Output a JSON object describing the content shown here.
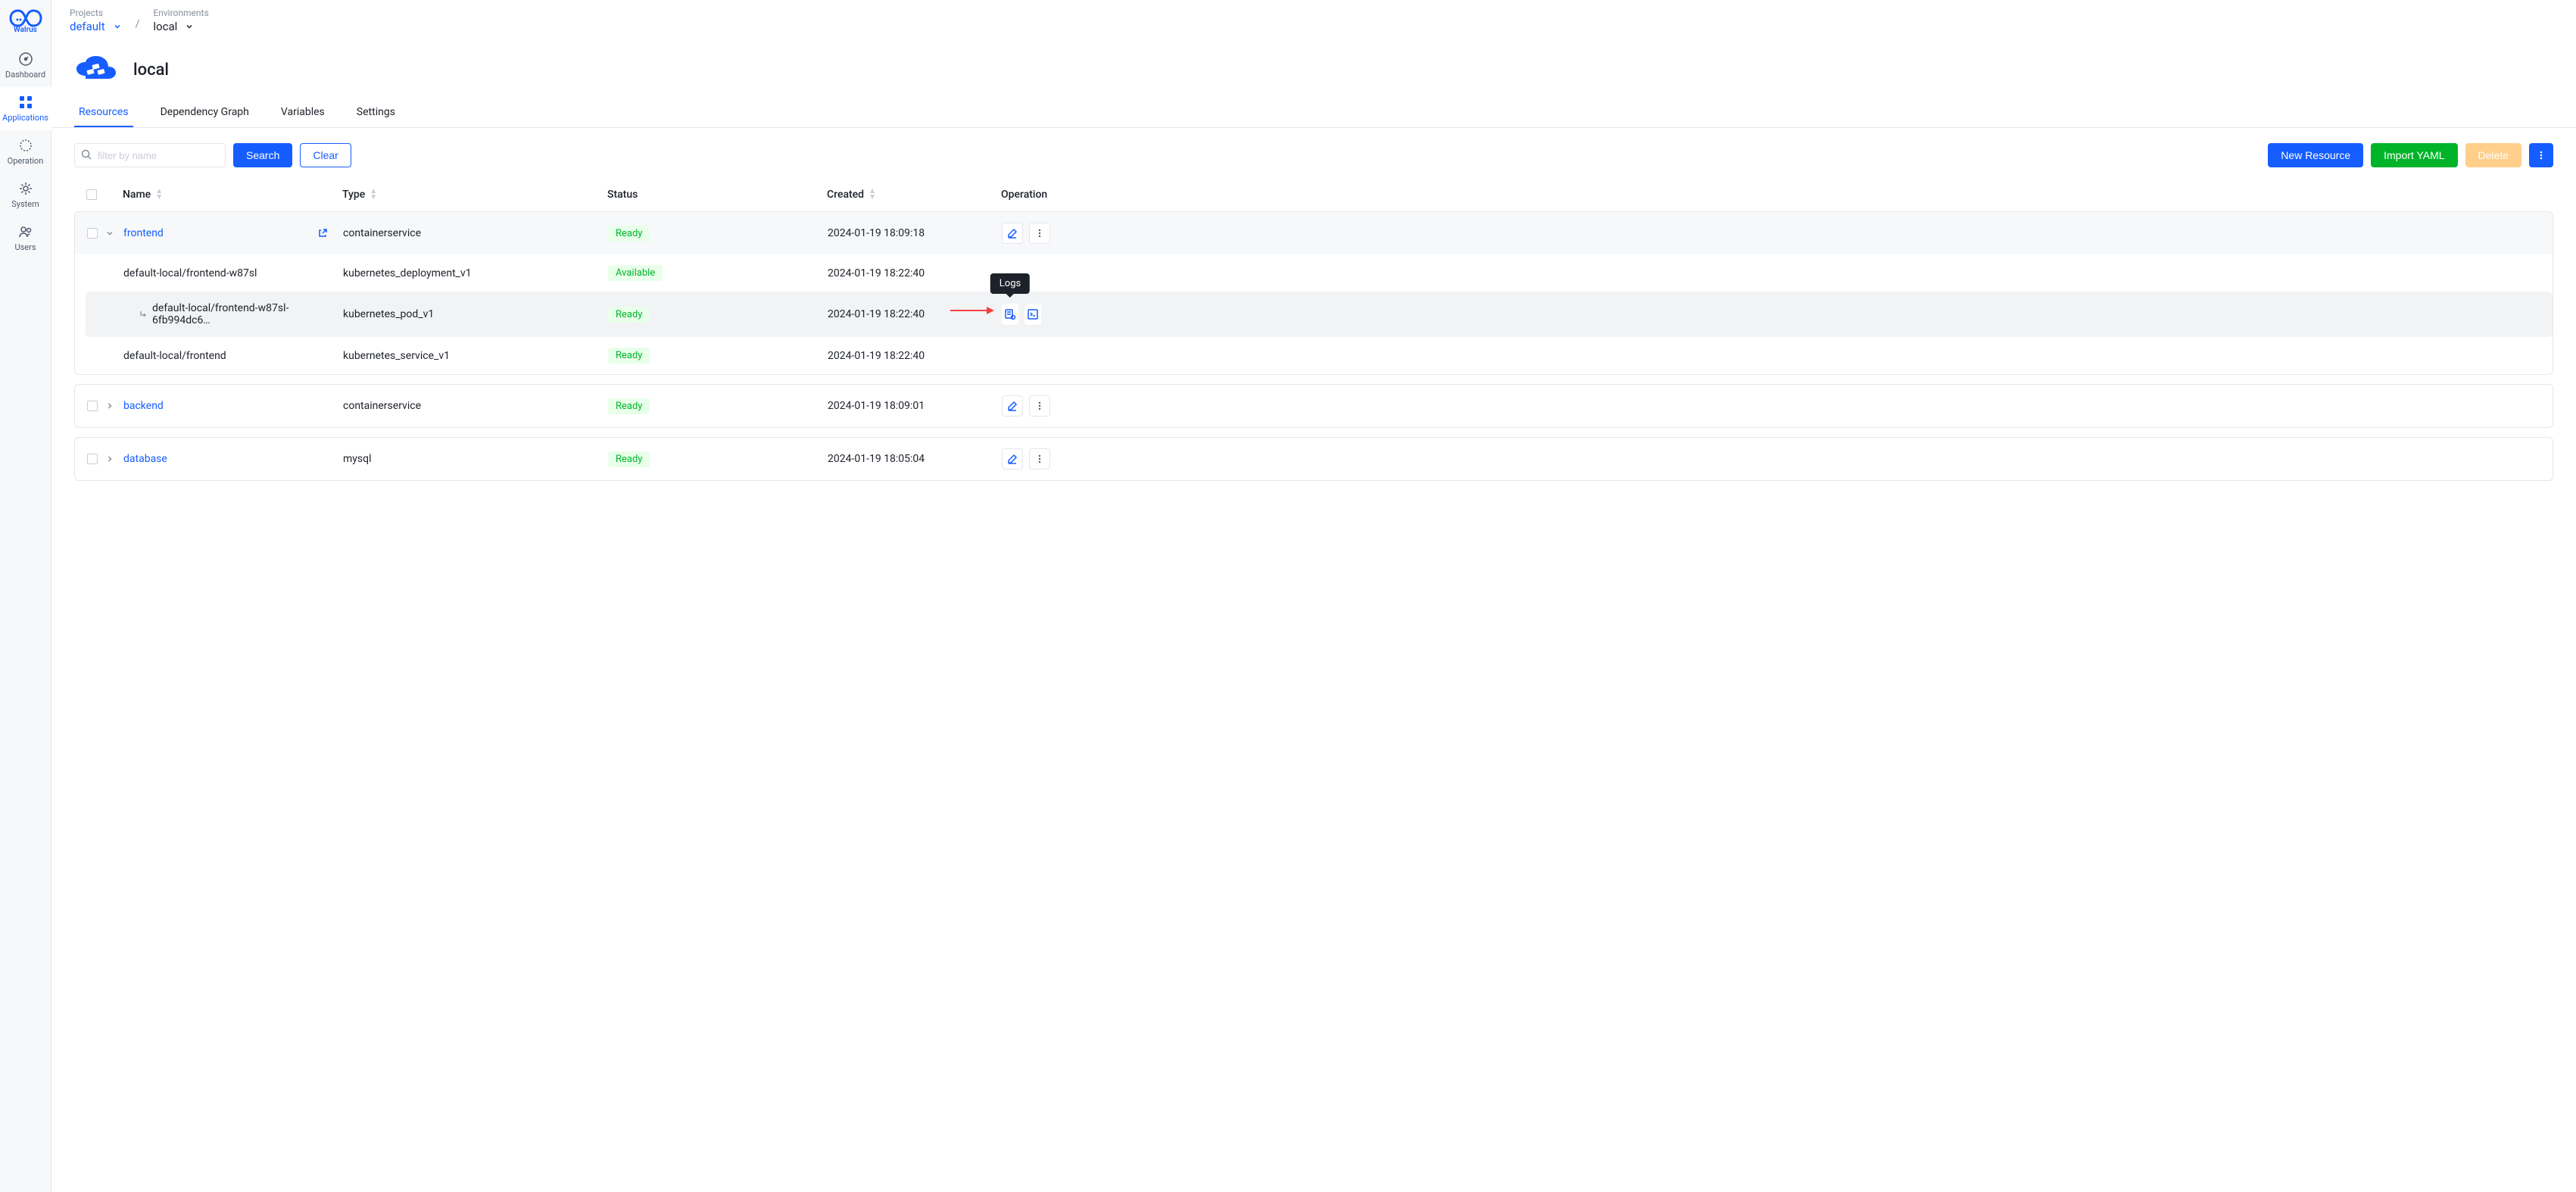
{
  "brand": "Walrus",
  "sidebar": {
    "items": [
      {
        "label": "Dashboard"
      },
      {
        "label": "Applications"
      },
      {
        "label": "Operation"
      },
      {
        "label": "System"
      },
      {
        "label": "Users"
      }
    ]
  },
  "breadcrumb": {
    "projects_label": "Projects",
    "project": "default",
    "envs_label": "Environments",
    "env": "local"
  },
  "env": {
    "title": "local"
  },
  "tabs": [
    "Resources",
    "Dependency Graph",
    "Variables",
    "Settings"
  ],
  "toolbar": {
    "search_placeholder": "filter by name",
    "search_btn": "Search",
    "clear_btn": "Clear",
    "new_btn": "New Resource",
    "import_btn": "Import YAML",
    "delete_btn": "Delete"
  },
  "columns": {
    "name": "Name",
    "type": "Type",
    "status": "Status",
    "created": "Created",
    "operation": "Operation"
  },
  "status": {
    "ready": "Ready",
    "available": "Available"
  },
  "tooltip": {
    "logs": "Logs"
  },
  "rows": {
    "frontend": {
      "name": "frontend",
      "type": "containerservice",
      "created": "2024-01-19 18:09:18",
      "children": [
        {
          "name": "default-local/frontend-w87sl",
          "type": "kubernetes_deployment_v1",
          "status": "Available",
          "created": "2024-01-19 18:22:40"
        },
        {
          "name": "default-local/frontend-w87sl-6fb994dc6…",
          "type": "kubernetes_pod_v1",
          "status": "Ready",
          "created": "2024-01-19 18:22:40",
          "highlight": true
        },
        {
          "name": "default-local/frontend",
          "type": "kubernetes_service_v1",
          "status": "Ready",
          "created": "2024-01-19 18:22:40"
        }
      ]
    },
    "backend": {
      "name": "backend",
      "type": "containerservice",
      "created": "2024-01-19 18:09:01"
    },
    "database": {
      "name": "database",
      "type": "mysql",
      "created": "2024-01-19 18:05:04"
    }
  }
}
